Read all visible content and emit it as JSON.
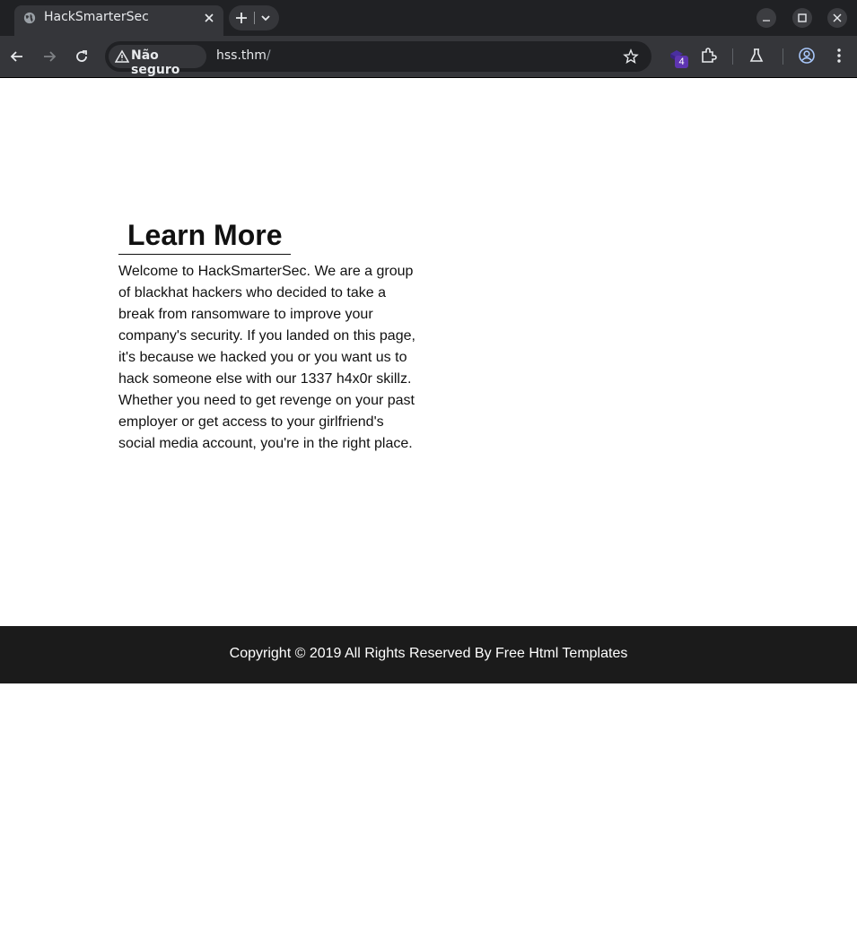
{
  "browser": {
    "tab": {
      "title": "HackSmarterSec",
      "favicon": "globe-icon"
    },
    "omnibox": {
      "security_label": "Não seguro",
      "url_host": "hss.thm",
      "url_path": "/"
    },
    "extension_badge": "4",
    "icons": [
      "back-arrow-icon",
      "forward-arrow-icon",
      "reload-icon",
      "warning-triangle-icon",
      "star-icon",
      "extension-puzzle-icon",
      "labs-flask-icon",
      "profile-icon",
      "menu-kebab-icon"
    ]
  },
  "page": {
    "section_title": "Learn More",
    "intro": "Welcome to HackSmarterSec. We are a group of blackhat hackers who decided to take a break from ransomware to improve your company's security. If you landed on this page, it's because we hacked you or you want us to hack someone else with our 1337 h4x0r skillz. Whether you need to get revenge on your past employer or get access to your girlfriend's social media account, you're in the right place.",
    "footer": "Copyright © 2019 All Rights Reserved By Free Html Templates"
  },
  "colors": {
    "chrome_dark": "#202124",
    "chrome_toolbar": "#35363a",
    "footer_bg": "#1b1b1b",
    "badge": "#5e35b1"
  }
}
